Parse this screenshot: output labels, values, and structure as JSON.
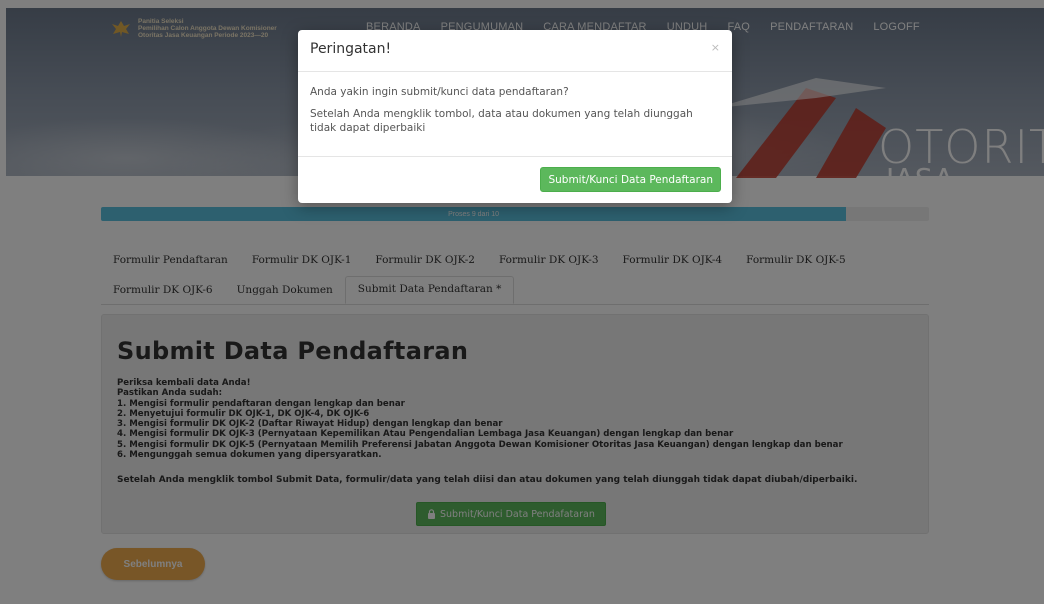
{
  "brand": {
    "lines": [
      "Panitia Seleksi",
      "Pemilihan Calon Anggota Dewan Komisioner",
      "Otoritas Jasa Keuangan Periode 2023—20"
    ]
  },
  "nav": {
    "items": [
      "BERANDA",
      "PENGUMUMAN",
      "CARA MENDAFTAR",
      "UNDUH",
      "FAQ",
      "PENDAFTARAN",
      "LOGOFF"
    ]
  },
  "hero": {
    "word1": "OTORITA",
    "word2": "JASA"
  },
  "progress": {
    "label": "Proses 9 dari 10",
    "fraction": 0.9
  },
  "tabs": {
    "row1": [
      "Formulir Pendaftaran",
      "Formulir DK OJK-1",
      "Formulir DK OJK-2",
      "Formulir DK OJK-3",
      "Formulir DK OJK-4",
      "Formulir DK OJK-5"
    ],
    "row2": [
      "Formulir DK OJK-6",
      "Unggah Dokumen",
      "Submit Data Pendaftaran *"
    ],
    "active": "Submit Data Pendaftaran *"
  },
  "main": {
    "title": "Submit Data Pendaftaran",
    "intro1": "Periksa kembali data Anda!",
    "intro2": "Pastikan Anda sudah:",
    "items": [
      "1. Mengisi formulir pendaftaran dengan lengkap dan benar",
      "2. Menyetujui formulir DK OJK-1, DK OJK-4, DK OJK-6",
      "3. Mengisi formulir DK OJK-2 (Daftar Riwayat Hidup) dengan lengkap dan benar",
      "4. Mengisi formulir DK OJK-3 (Pernyataan Kepemilikan Atau Pengendalian Lembaga Jasa Keuangan) dengan lengkap dan benar",
      "5. Mengisi formulir DK OJK-5 (Pernyataan Memilih Preferensi Jabatan Anggota Dewan Komisioner Otoritas Jasa Keuangan) dengan lengkap dan benar",
      "6. Mengunggah semua dokumen yang dipersyaratkan."
    ],
    "note": "Setelah Anda mengklik tombol Submit Data, formulir/data yang telah diisi dan atau dokumen yang telah diunggah tidak dapat diubah/diperbaiki.",
    "submit_label": "Submit/Kunci Data Pendafataran"
  },
  "prev_label": "Sebelumnya",
  "modal": {
    "title": "Peringatan!",
    "close": "×",
    "question": "Anda yakin ingin submit/kunci data pendaftaran?",
    "warning": "Setelah Anda mengklik tombol, data atau dokumen yang telah diunggah tidak dapat diperbaiki",
    "submit_label": "Submit/Kunci Data Pendaftaran"
  },
  "colors": {
    "progress": "#5bc0de",
    "success": "#5cb85c",
    "warning": "#f0ad4e"
  }
}
